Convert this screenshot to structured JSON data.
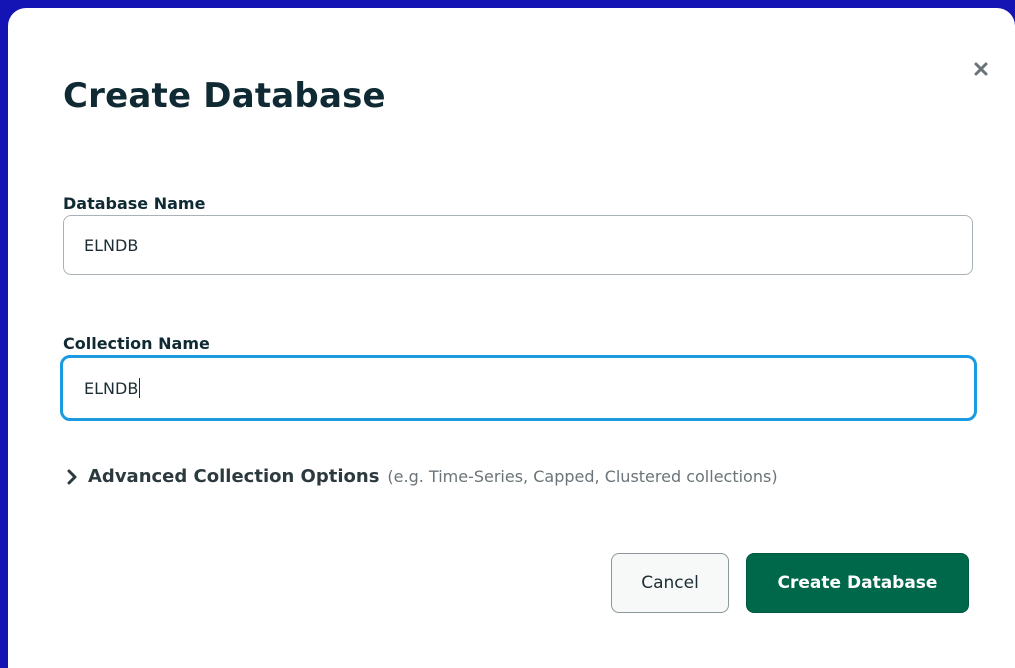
{
  "dialog": {
    "title": "Create Database",
    "close_icon": "close-icon"
  },
  "database_name": {
    "label": "Database Name",
    "value": "ELNDB"
  },
  "collection_name": {
    "label": "Collection Name",
    "value": "ELNDB"
  },
  "advanced_options": {
    "icon": "chevron-right-icon",
    "label": "Advanced Collection Options",
    "hint": "(e.g. Time-Series, Capped, Clustered collections)"
  },
  "buttons": {
    "cancel_label": "Cancel",
    "create_label": "Create Database"
  },
  "colors": {
    "primary_button": "#00684a",
    "focus_border": "#1a9ae0",
    "title_text": "#0f2a33"
  }
}
